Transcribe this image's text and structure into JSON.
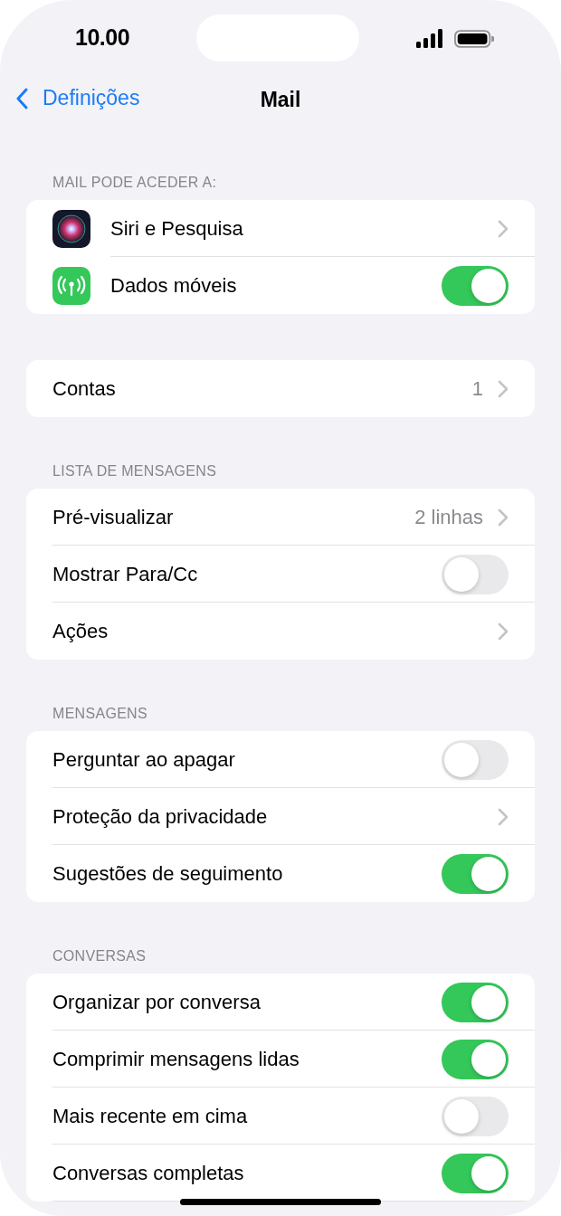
{
  "status_bar": {
    "time": "10.00"
  },
  "nav": {
    "back": "Definições",
    "title": "Mail"
  },
  "groups": [
    {
      "header": "MAIL PODE ACEDER A:",
      "rows": [
        {
          "kind": "nav",
          "label": "Siri e Pesquisa"
        },
        {
          "kind": "toggle",
          "label": "Dados móveis",
          "on": true
        }
      ]
    },
    {
      "rows": [
        {
          "kind": "nav",
          "label": "Contas",
          "value": "1"
        }
      ]
    },
    {
      "header": "LISTA DE MENSAGENS",
      "rows": [
        {
          "kind": "nav",
          "label": "Pré-visualizar",
          "value": "2 linhas"
        },
        {
          "kind": "toggle",
          "label": "Mostrar Para/Cc",
          "on": false
        },
        {
          "kind": "nav",
          "label": "Ações"
        }
      ]
    },
    {
      "header": "MENSAGENS",
      "rows": [
        {
          "kind": "toggle",
          "label": "Perguntar ao apagar",
          "on": false
        },
        {
          "kind": "nav",
          "label": "Proteção da privacidade"
        },
        {
          "kind": "toggle",
          "label": "Sugestões de seguimento",
          "on": true
        }
      ]
    },
    {
      "header": "CONVERSAS",
      "rows": [
        {
          "kind": "toggle",
          "label": "Organizar por conversa",
          "on": true
        },
        {
          "kind": "toggle",
          "label": "Comprimir mensagens lidas",
          "on": true
        },
        {
          "kind": "toggle",
          "label": "Mais recente em cima",
          "on": false
        },
        {
          "kind": "toggle",
          "label": "Conversas completas",
          "on": true
        }
      ]
    }
  ]
}
